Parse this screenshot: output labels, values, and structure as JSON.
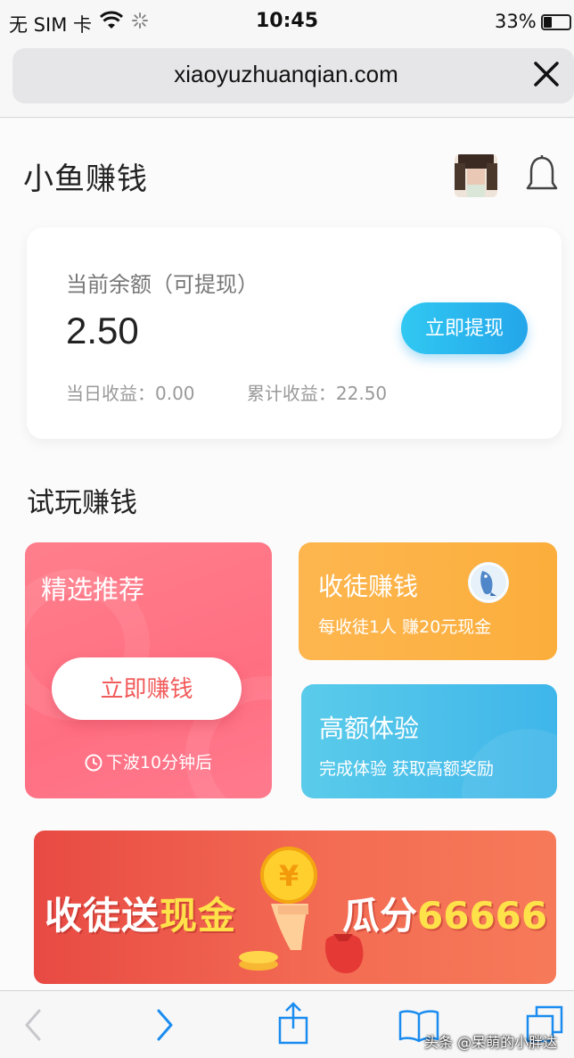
{
  "status_bar": {
    "carrier": "无 SIM 卡",
    "time": "10:45",
    "battery": "33%",
    "battery_level": 0.33
  },
  "browser": {
    "url": "xiaoyuzhuanqian.com"
  },
  "header": {
    "title": "小鱼赚钱"
  },
  "balance": {
    "label": "当前余额（可提现）",
    "amount": "2.50",
    "withdraw_label": "立即提现",
    "today": "当日收益：0.00",
    "total": "累计收益：22.50"
  },
  "section": {
    "title": "试玩赚钱"
  },
  "cards": {
    "featured": {
      "title": "精选推荐",
      "button": "立即赚钱",
      "next_wave": "下波10分钟后"
    },
    "invite": {
      "title": "收徒赚钱",
      "subtitle": "每收徒1人 赚20元现金"
    },
    "experience": {
      "title": "高额体验",
      "subtitle": "完成体验 获取高额奖励"
    }
  },
  "banner": {
    "left_white": "收徒送",
    "left_gold": "现金",
    "right_white": "瓜分",
    "right_gold": "66666",
    "coin_symbol": "¥"
  },
  "watermark": "头条 @呆萌的小胖达",
  "colors": {
    "accent_blue": "#23a6ea",
    "featured_pink": "#ff6f82",
    "invite_orange": "#fcae3c",
    "experience_blue": "#3fb6ea",
    "banner_red": "#e84a43",
    "ios_blue": "#1a8cf0"
  },
  "icons": {
    "wifi": "wifi-icon",
    "spinner": "loading-icon",
    "close": "close-icon",
    "bell": "bell-icon",
    "clock": "clock-icon",
    "fish": "fish-icon",
    "back": "back-icon",
    "forward": "forward-icon",
    "share": "share-icon",
    "bookmarks": "bookmarks-icon",
    "tabs": "tabs-icon"
  }
}
